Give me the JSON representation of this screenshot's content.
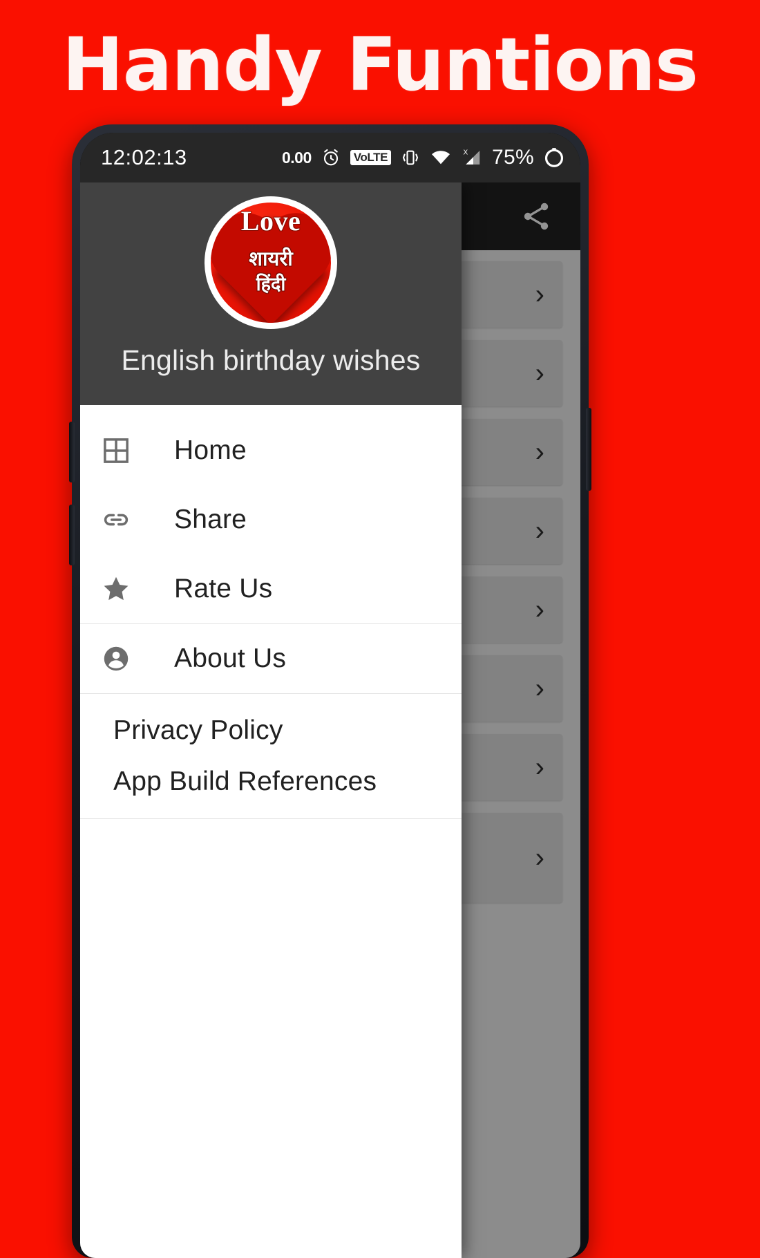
{
  "promo": {
    "title": "Handy Funtions",
    "background_color": "#fa1000",
    "title_color": "#fdf4f2"
  },
  "statusbar": {
    "clock": "12:02:13",
    "data_rate": "0.00",
    "alarm_icon": "alarm-clock-icon",
    "volte_label": "VoLTE",
    "vibrate_icon": "vibrate-icon",
    "wifi_icon": "wifi-icon",
    "signal_icon": "signal-no-sim-icon",
    "signal_badge": "X",
    "battery_percent": "75%",
    "battery_icon": "battery-circle-icon",
    "background_color": "#272727"
  },
  "toolbar": {
    "title": "",
    "share_icon": "share-icon",
    "background_color": "#212121"
  },
  "main": {
    "cards": [
      {
        "title": "",
        "chevron": "›"
      },
      {
        "title": "",
        "chevron": "›"
      },
      {
        "title": "",
        "chevron": "›"
      },
      {
        "title": "",
        "chevron": "›"
      },
      {
        "title": "",
        "chevron": "›"
      },
      {
        "title": "",
        "chevron": "›"
      },
      {
        "title": "",
        "chevron": "›"
      },
      {
        "title": "",
        "chevron": "›"
      }
    ]
  },
  "drawer": {
    "header": {
      "logo": {
        "name": "app-logo",
        "line_love": "Love",
        "line_hindi_1": "शायरी",
        "line_hindi_2": "हिंदी"
      },
      "subtitle": "English birthday wishes",
      "background_color": "#424242"
    },
    "primary_items": [
      {
        "label": "Home",
        "icon": "grid-icon"
      },
      {
        "label": "Share",
        "icon": "link-icon"
      },
      {
        "label": "Rate Us",
        "icon": "star-icon"
      }
    ],
    "secondary_items": [
      {
        "label": "About Us",
        "icon": "account-circle-icon"
      }
    ],
    "tertiary_items": [
      {
        "label": "Privacy Policy"
      },
      {
        "label": "App Build References"
      }
    ]
  }
}
